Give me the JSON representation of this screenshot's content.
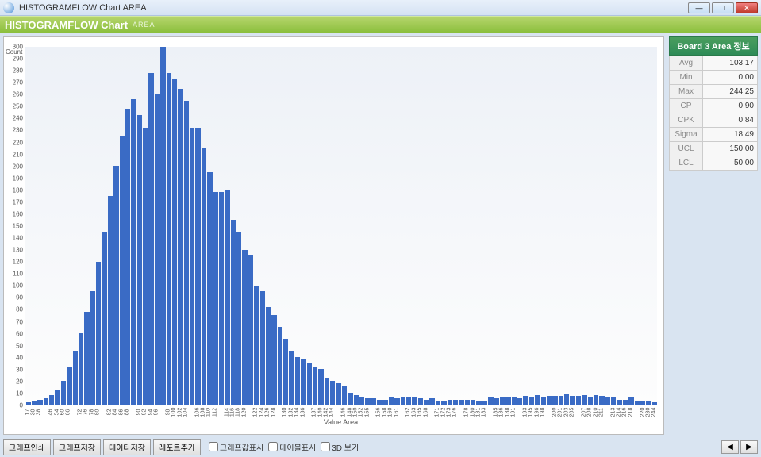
{
  "window": {
    "title": "HISTOGRAMFLOW Chart AREA"
  },
  "header": {
    "title": "HISTOGRAMFLOW Chart",
    "subtitle": "AREA"
  },
  "side": {
    "title": "Board 3 Area 정보",
    "stats": [
      {
        "k": "Avg",
        "v": "103.17"
      },
      {
        "k": "Min",
        "v": "0.00"
      },
      {
        "k": "Max",
        "v": "244.25"
      },
      {
        "k": "CP",
        "v": "0.90"
      },
      {
        "k": "CPK",
        "v": "0.84"
      },
      {
        "k": "Sigma",
        "v": "18.49"
      },
      {
        "k": "UCL",
        "v": "150.00"
      },
      {
        "k": "LCL",
        "v": "50.00"
      }
    ]
  },
  "bottom": {
    "buttons": [
      "그래프인쇄",
      "그래프저장",
      "데이타저장",
      "레포트추가"
    ],
    "checks": [
      "그래프값표시",
      "테이블표시",
      "3D 보기"
    ]
  },
  "chart_data": {
    "type": "bar",
    "title": "",
    "xlabel": "Value Area",
    "ylabel": "Count",
    "ylim": [
      0,
      300
    ],
    "y_ticks": [
      0,
      10,
      20,
      30,
      40,
      50,
      60,
      70,
      80,
      90,
      100,
      110,
      120,
      130,
      140,
      150,
      160,
      170,
      180,
      190,
      200,
      210,
      220,
      230,
      240,
      250,
      260,
      270,
      280,
      290,
      300
    ],
    "categories": [
      17,
      30,
      38,
      46,
      54,
      60,
      66,
      72,
      76,
      78,
      80,
      82,
      84,
      86,
      88,
      90,
      92,
      94,
      96,
      98,
      100,
      102,
      104,
      106,
      108,
      110,
      112,
      114,
      116,
      118,
      120,
      122,
      124,
      126,
      128,
      130,
      132,
      134,
      136,
      137,
      140,
      142,
      144,
      146,
      148,
      150,
      152,
      155,
      156,
      158,
      160,
      161,
      162,
      163,
      165,
      168,
      171,
      172,
      173,
      176,
      178,
      180,
      181,
      183,
      185,
      186,
      188,
      191,
      193,
      195,
      196,
      198,
      200,
      201,
      203,
      205,
      207,
      208,
      210,
      211,
      213,
      214,
      216,
      218,
      220,
      230,
      244
    ],
    "values": [
      2,
      3,
      4,
      5,
      8,
      12,
      20,
      32,
      45,
      60,
      78,
      95,
      120,
      145,
      175,
      200,
      225,
      248,
      256,
      243,
      232,
      278,
      260,
      300,
      278,
      273,
      265,
      255,
      232,
      232,
      215,
      195,
      178,
      178,
      180,
      155,
      145,
      130,
      125,
      100,
      95,
      82,
      75,
      65,
      55,
      45,
      40,
      38,
      35,
      32,
      30,
      22,
      20,
      18,
      15,
      10,
      8,
      6,
      5,
      5,
      4,
      4,
      6,
      5,
      6,
      6,
      6,
      5,
      4,
      5,
      3,
      3,
      4,
      4,
      4,
      4,
      4,
      3,
      3,
      6,
      5,
      6,
      6,
      6,
      5,
      7,
      6,
      8,
      6,
      7,
      7,
      7,
      9,
      7,
      7,
      8,
      6,
      8,
      7,
      6,
      6,
      4,
      4,
      6,
      3,
      3,
      3,
      2
    ]
  }
}
